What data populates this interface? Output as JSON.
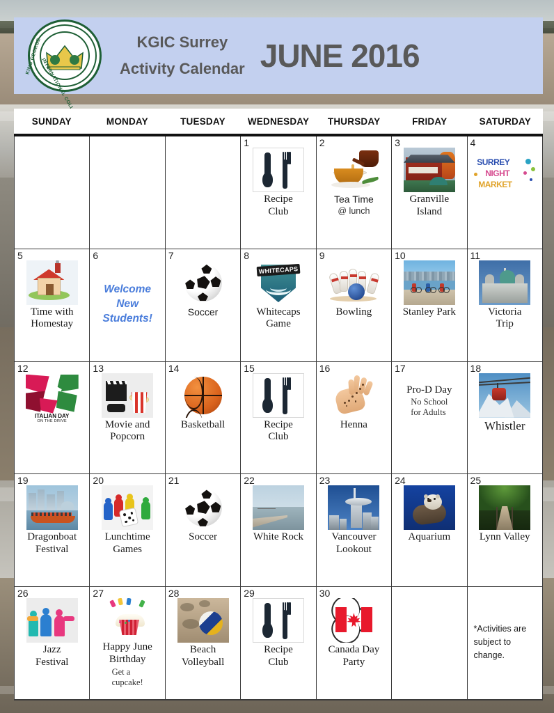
{
  "header": {
    "org_line1": "KGIC Surrey",
    "org_line2": "Activity Calendar",
    "month_title": "JUNE 2016",
    "logo": {
      "top_text": "KING GEORGE",
      "bottom_text": "INTERNATIONAL COLLEGE",
      "icon": "crown-icon"
    },
    "band_color": "#c3d0ef",
    "title_color": "#595959"
  },
  "calendar": {
    "weekday_headers": [
      "SUNDAY",
      "MONDAY",
      "TUESDAY",
      "WEDNESDAY",
      "THURSDAY",
      "FRIDAY",
      "SATURDAY"
    ],
    "weeks": [
      [
        {
          "day": "",
          "icon": "",
          "lines": [],
          "sub": ""
        },
        {
          "day": "",
          "icon": "",
          "lines": [],
          "sub": ""
        },
        {
          "day": "",
          "icon": "",
          "lines": [],
          "sub": ""
        },
        {
          "day": "1",
          "icon": "cutlery-icon",
          "lines": [
            "Recipe",
            "Club"
          ],
          "sub": ""
        },
        {
          "day": "2",
          "icon": "teacup-icon",
          "lines": [
            "Tea Time"
          ],
          "sub": "@ lunch",
          "style": "sans"
        },
        {
          "day": "3",
          "icon": "granville-market-photo",
          "lines": [
            "Granville",
            "Island"
          ],
          "sub": ""
        },
        {
          "day": "4",
          "icon": "surrey-night-market-logo",
          "lines": [],
          "sub": "",
          "logo_text": [
            "SURREY",
            "NIGHT",
            "MARKET"
          ]
        }
      ],
      [
        {
          "day": "5",
          "icon": "house-icon",
          "lines": [
            "Time with",
            "Homestay"
          ],
          "sub": ""
        },
        {
          "day": "6",
          "icon": "",
          "lines": [],
          "sub": "",
          "highlight": "Welcome New Students!"
        },
        {
          "day": "7",
          "icon": "soccer-ball-icon",
          "lines": [
            "Soccer"
          ],
          "sub": "",
          "style": "sans"
        },
        {
          "day": "8",
          "icon": "whitecaps-crest-logo",
          "lines": [
            "Whitecaps",
            "Game"
          ],
          "sub": "",
          "logo_text": "WHITECAPS"
        },
        {
          "day": "9",
          "icon": "bowling-icon",
          "lines": [
            "Bowling"
          ],
          "sub": ""
        },
        {
          "day": "10",
          "icon": "stanley-park-photo",
          "lines": [
            "Stanley Park"
          ],
          "sub": ""
        },
        {
          "day": "11",
          "icon": "victoria-parliament-photo",
          "lines": [
            "Victoria",
            "Trip"
          ],
          "sub": ""
        }
      ],
      [
        {
          "day": "12",
          "icon": "italian-day-logo",
          "lines": [],
          "sub": "",
          "logo_text": [
            "ITALIAN DAY",
            "ON THE DRIVE"
          ]
        },
        {
          "day": "13",
          "icon": "movie-popcorn-icon",
          "lines": [
            "Movie and",
            "Popcorn"
          ],
          "sub": ""
        },
        {
          "day": "14",
          "icon": "basketball-icon",
          "lines": [
            "Basketball"
          ],
          "sub": ""
        },
        {
          "day": "15",
          "icon": "cutlery-icon",
          "lines": [
            "Recipe",
            "Club"
          ],
          "sub": ""
        },
        {
          "day": "16",
          "icon": "henna-hand-photo",
          "lines": [
            "Henna"
          ],
          "sub": ""
        },
        {
          "day": "17",
          "icon": "",
          "lines": [
            "Pro-D Day"
          ],
          "sub": "No School\nfor Adults",
          "text_only": true
        },
        {
          "day": "18",
          "icon": "whistler-gondola-photo",
          "lines": [
            "Whistler"
          ],
          "sub": ""
        }
      ],
      [
        {
          "day": "19",
          "icon": "dragonboat-photo",
          "lines": [
            "Dragonboat",
            "Festival"
          ],
          "sub": ""
        },
        {
          "day": "20",
          "icon": "board-game-icon",
          "lines": [
            "Lunchtime",
            "Games"
          ],
          "sub": ""
        },
        {
          "day": "21",
          "icon": "soccer-ball-icon",
          "lines": [
            "Soccer"
          ],
          "sub": ""
        },
        {
          "day": "22",
          "icon": "white-rock-pier-photo",
          "lines": [
            "White Rock"
          ],
          "sub": ""
        },
        {
          "day": "23",
          "icon": "vancouver-lookout-photo",
          "lines": [
            "Vancouver",
            "Lookout"
          ],
          "sub": ""
        },
        {
          "day": "24",
          "icon": "sea-otter-photo",
          "lines": [
            "Aquarium"
          ],
          "sub": ""
        },
        {
          "day": "25",
          "icon": "lynn-valley-bridge-photo",
          "lines": [
            "Lynn Valley"
          ],
          "sub": ""
        }
      ],
      [
        {
          "day": "26",
          "icon": "jazz-festival-logo",
          "lines": [
            "Jazz",
            "Festival"
          ],
          "sub": ""
        },
        {
          "day": "27",
          "icon": "birthday-cupcake-icon",
          "lines": [
            "Happy June",
            "Birthday"
          ],
          "sub": "Get a\ncupcake!"
        },
        {
          "day": "28",
          "icon": "beach-volleyball-photo",
          "lines": [
            "Beach",
            "Volleyball"
          ],
          "sub": ""
        },
        {
          "day": "29",
          "icon": "cutlery-icon",
          "lines": [
            "Recipe",
            "Club"
          ],
          "sub": ""
        },
        {
          "day": "30",
          "icon": "canada-heart-icon",
          "lines": [
            "Canada Day",
            "Party"
          ],
          "sub": ""
        },
        {
          "day": "",
          "icon": "",
          "lines": [],
          "sub": ""
        },
        {
          "day": "",
          "icon": "",
          "lines": [],
          "sub": "",
          "note": "*Activities are subject to change."
        }
      ]
    ],
    "footnote": "*Activities are subject to change."
  },
  "colors": {
    "header_band": "#c3d0ef",
    "header_text": "#595959",
    "highlight_text": "#4a7ddb",
    "grid_line": "#3a3a3a",
    "logo_green": "#1e5f35"
  }
}
